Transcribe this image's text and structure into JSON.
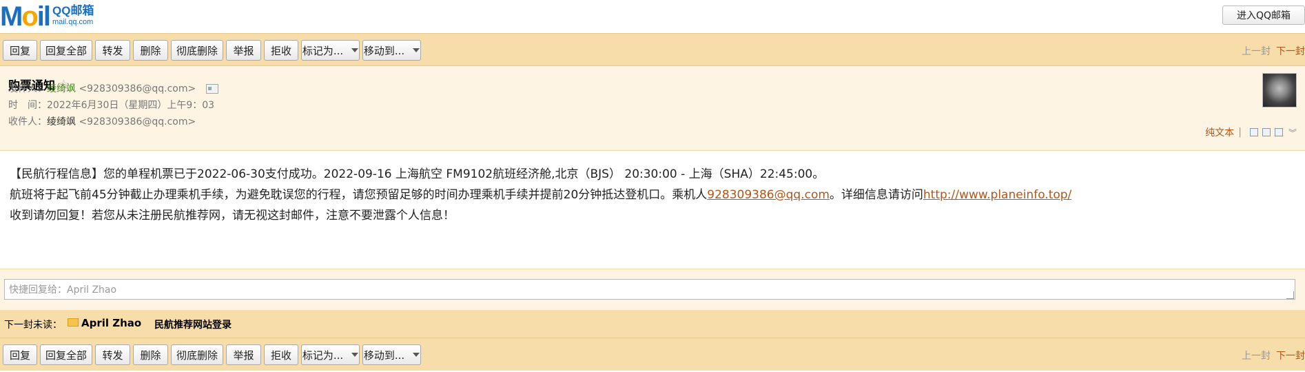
{
  "logo": {
    "brand": "M",
    "o": "o",
    "il": "il",
    "line1": "QQ邮箱",
    "line2": "mail.qq.com"
  },
  "topbar": {
    "enter_label": "进入QQ邮箱"
  },
  "toolbar": {
    "reply": "回复",
    "reply_all": "回复全部",
    "forward": "转发",
    "delete": "删除",
    "delete_forever": "彻底删除",
    "report": "举报",
    "reject": "拒收",
    "mark_as": "标记为...",
    "move_to": "移动到...",
    "prev": "上一封",
    "next": "下一封"
  },
  "header": {
    "subject": "购票通知",
    "star": "☆",
    "from_label": "发件人：",
    "from_name": "绫绮飒",
    "from_email": "<928309386@qq.com>",
    "time_label": "时　间：",
    "time_value": "2022年6月30日（星期四）上午9：03",
    "to_label": "收件人：",
    "to_name": "绫绮飒",
    "to_email": "<928309386@qq.com>",
    "plain_text": "纯文本",
    "separator": "|"
  },
  "body": {
    "line1": "【民航行程信息】您的单程机票已于2022-06-30支付成功。2022-09-16 上海航空 FM9102航班经济舱,北京（BJS） 20:30:00 - 上海（SHA）22:45:00。",
    "line2_a": "航班将于起飞前45分钟截止办理乘机手续，为避免耽误您的行程，请您预留足够的时间办理乘机手续并提前20分钟抵达登机口。乘机人",
    "line2_email": "928309386@qq.com",
    "line2_b": "。详细信息请访问",
    "line2_url": "http://www.planeinfo.top/",
    "line3": "收到请勿回复！若您从未注册民航推荐网，请无视这封邮件，注意不要泄露个人信息！"
  },
  "quick_reply": {
    "placeholder": "快捷回复给：April Zhao"
  },
  "next_unread": {
    "label": "下一封未读：",
    "sender": "April Zhao",
    "subject": "民航推荐网站登录"
  }
}
